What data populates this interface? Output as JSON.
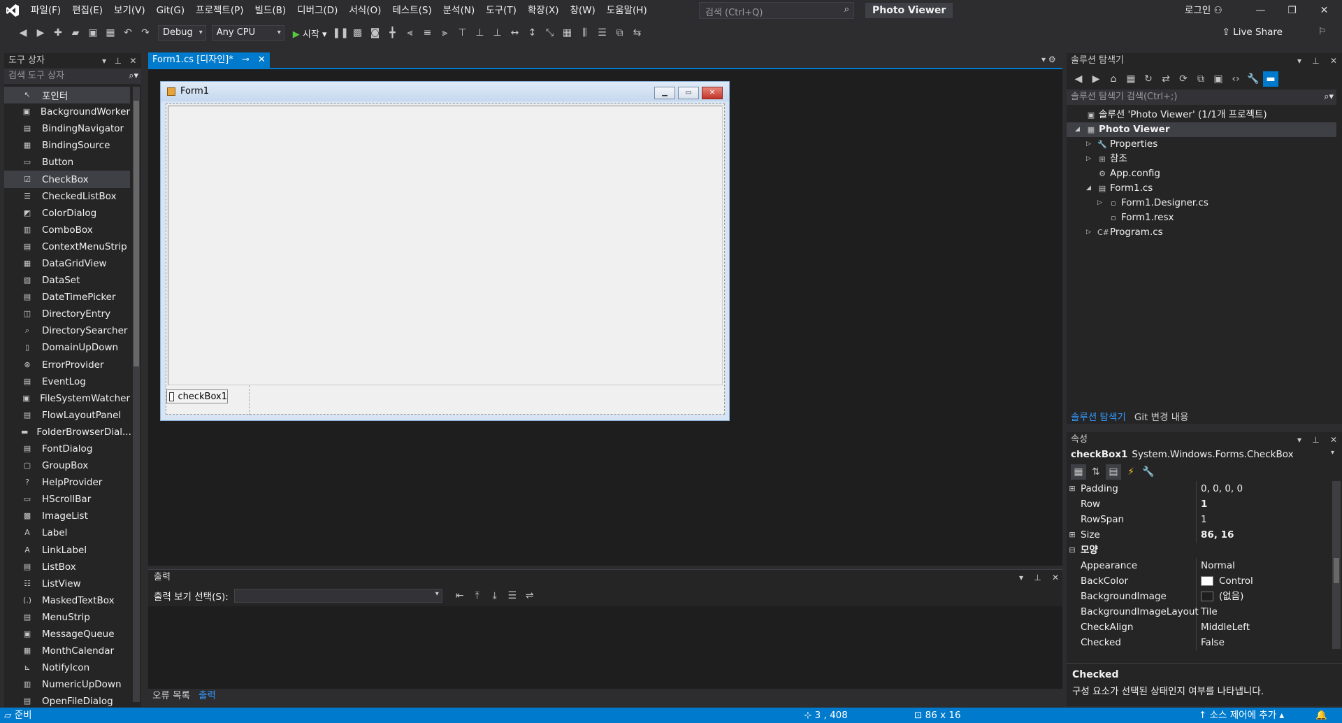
{
  "menu": {
    "logo": "VS",
    "items": [
      "파일(F)",
      "편집(E)",
      "보기(V)",
      "Git(G)",
      "프로젝트(P)",
      "빌드(B)",
      "디버그(D)",
      "서식(O)",
      "테스트(S)",
      "분석(N)",
      "도구(T)",
      "확장(X)",
      "창(W)",
      "도움말(H)"
    ],
    "search_placeholder": "검색 (Ctrl+Q)",
    "project_title": "Photo Viewer",
    "login": "로그인"
  },
  "toolbar": {
    "config": "Debug",
    "platform": "Any CPU",
    "start": "시작",
    "live_share": "Live Share"
  },
  "toolbox": {
    "title": "도구 상자",
    "search_placeholder": "검색 도구 상자",
    "items": [
      {
        "label": "포인터",
        "icon": "↖"
      },
      {
        "label": "BackgroundWorker",
        "icon": "▣"
      },
      {
        "label": "BindingNavigator",
        "icon": "▤"
      },
      {
        "label": "BindingSource",
        "icon": "▦"
      },
      {
        "label": "Button",
        "icon": "▭"
      },
      {
        "label": "CheckBox",
        "icon": "☑"
      },
      {
        "label": "CheckedListBox",
        "icon": "☰"
      },
      {
        "label": "ColorDialog",
        "icon": "◩"
      },
      {
        "label": "ComboBox",
        "icon": "▥"
      },
      {
        "label": "ContextMenuStrip",
        "icon": "▤"
      },
      {
        "label": "DataGridView",
        "icon": "▦"
      },
      {
        "label": "DataSet",
        "icon": "▧"
      },
      {
        "label": "DateTimePicker",
        "icon": "▤"
      },
      {
        "label": "DirectoryEntry",
        "icon": "◫"
      },
      {
        "label": "DirectorySearcher",
        "icon": "⌕"
      },
      {
        "label": "DomainUpDown",
        "icon": "▯"
      },
      {
        "label": "ErrorProvider",
        "icon": "⊗"
      },
      {
        "label": "EventLog",
        "icon": "▤"
      },
      {
        "label": "FileSystemWatcher",
        "icon": "▣"
      },
      {
        "label": "FlowLayoutPanel",
        "icon": "▤"
      },
      {
        "label": "FolderBrowserDial...",
        "icon": "▬"
      },
      {
        "label": "FontDialog",
        "icon": "▤"
      },
      {
        "label": "GroupBox",
        "icon": "▢"
      },
      {
        "label": "HelpProvider",
        "icon": "?"
      },
      {
        "label": "HScrollBar",
        "icon": "▭"
      },
      {
        "label": "ImageList",
        "icon": "▩"
      },
      {
        "label": "Label",
        "icon": "A"
      },
      {
        "label": "LinkLabel",
        "icon": "A"
      },
      {
        "label": "ListBox",
        "icon": "▤"
      },
      {
        "label": "ListView",
        "icon": "☷"
      },
      {
        "label": "MaskedTextBox",
        "icon": "(.)"
      },
      {
        "label": "MenuStrip",
        "icon": "▤"
      },
      {
        "label": "MessageQueue",
        "icon": "▣"
      },
      {
        "label": "MonthCalendar",
        "icon": "▦"
      },
      {
        "label": "NotifyIcon",
        "icon": "⊾"
      },
      {
        "label": "NumericUpDown",
        "icon": "▥"
      },
      {
        "label": "OpenFileDialog",
        "icon": "▤"
      }
    ]
  },
  "document": {
    "tab_label": "Form1.cs [디자인]*",
    "form_title": "Form1",
    "checkbox_text": "checkBox1"
  },
  "output": {
    "title": "출력",
    "select_label": "출력 보기 선택(S):",
    "tabs": [
      "오류 목록",
      "출력"
    ]
  },
  "solution": {
    "title": "솔루션 탐색기",
    "search_placeholder": "솔루션 탐색기 검색(Ctrl+;)",
    "tree": [
      {
        "label": "솔루션 'Photo Viewer' (1/1개 프로젝트)",
        "indent": 0,
        "arrow": "",
        "icon": "▣"
      },
      {
        "label": "Photo Viewer",
        "indent": 0,
        "arrow": "◢",
        "icon": "▦"
      },
      {
        "label": "Properties",
        "indent": 1,
        "arrow": "▷",
        "icon": "🔧"
      },
      {
        "label": "참조",
        "indent": 1,
        "arrow": "▷",
        "icon": "⊞"
      },
      {
        "label": "App.config",
        "indent": 1,
        "arrow": "",
        "icon": "⚙"
      },
      {
        "label": "Form1.cs",
        "indent": 1,
        "arrow": "◢",
        "icon": "▤"
      },
      {
        "label": "Form1.Designer.cs",
        "indent": 2,
        "arrow": "▷",
        "icon": "▫"
      },
      {
        "label": "Form1.resx",
        "indent": 2,
        "arrow": "",
        "icon": "▫"
      },
      {
        "label": "Program.cs",
        "indent": 1,
        "arrow": "▷",
        "icon": "C#"
      }
    ],
    "tabs": [
      "솔루션 탐색기",
      "Git 변경 내용"
    ]
  },
  "properties": {
    "title": "속성",
    "object_name": "checkBox1",
    "object_type": "System.Windows.Forms.CheckBox",
    "rows": [
      {
        "expander": "⊞",
        "name": "Padding",
        "value": "0, 0, 0, 0",
        "bold": false,
        "category": false
      },
      {
        "expander": "",
        "name": "Row",
        "value": "1",
        "bold": true,
        "category": false
      },
      {
        "expander": "",
        "name": "RowSpan",
        "value": "1",
        "bold": false,
        "category": false
      },
      {
        "expander": "⊞",
        "name": "Size",
        "value": "86, 16",
        "bold": true,
        "category": false
      },
      {
        "expander": "⊟",
        "name": "모양",
        "value": "",
        "bold": false,
        "category": true
      },
      {
        "expander": "",
        "name": "Appearance",
        "value": "Normal",
        "bold": false,
        "category": false
      },
      {
        "expander": "",
        "name": "BackColor",
        "value": "Control",
        "bold": false,
        "category": false,
        "swatch": "#ffffff"
      },
      {
        "expander": "",
        "name": "BackgroundImage",
        "value": "(없음)",
        "bold": false,
        "category": false,
        "swatch": "#1e1e1e"
      },
      {
        "expander": "",
        "name": "BackgroundImageLayout",
        "value": "Tile",
        "bold": false,
        "category": false
      },
      {
        "expander": "",
        "name": "CheckAlign",
        "value": "MiddleLeft",
        "bold": false,
        "category": false
      },
      {
        "expander": "",
        "name": "Checked",
        "value": "False",
        "bold": false,
        "category": false
      }
    ],
    "desc_title": "Checked",
    "desc_text": "구성 요소가 선택된 상태인지 여부를 나타냅니다."
  },
  "status": {
    "ready": "준비",
    "position": "3 , 408",
    "size": "86 x 16",
    "source_control": "소스 제어에 추가"
  },
  "colors": {
    "accent": "#007acc",
    "background": "#2d2d30"
  }
}
